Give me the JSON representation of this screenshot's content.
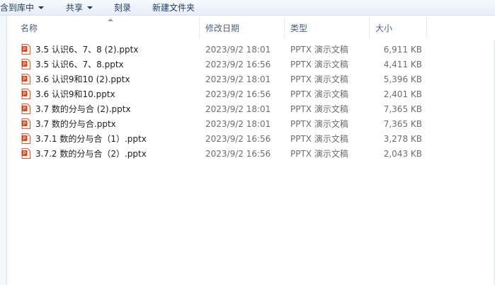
{
  "toolbar": {
    "include_library": "含到库中",
    "share": "共享",
    "burn": "刻录",
    "new_folder": "新建文件夹"
  },
  "columns": {
    "name": "名称",
    "modified": "修改日期",
    "type": "类型",
    "size": "大小"
  },
  "files": [
    {
      "name": "3.5 认识6、7、8 (2).pptx",
      "modified": "2023/9/2 18:01",
      "type": "PPTX 演示文稿",
      "size": "6,911 KB"
    },
    {
      "name": "3.5 认识6、7、8.pptx",
      "modified": "2023/9/2 16:56",
      "type": "PPTX 演示文稿",
      "size": "4,411 KB"
    },
    {
      "name": "3.6 认识9和10 (2).pptx",
      "modified": "2023/9/2 18:01",
      "type": "PPTX 演示文稿",
      "size": "5,396 KB"
    },
    {
      "name": "3.6 认识9和10.pptx",
      "modified": "2023/9/2 16:56",
      "type": "PPTX 演示文稿",
      "size": "2,401 KB"
    },
    {
      "name": "3.7 数的分与合 (2).pptx",
      "modified": "2023/9/2 18:01",
      "type": "PPTX 演示文稿",
      "size": "7,365 KB"
    },
    {
      "name": "3.7 数的分与合.pptx",
      "modified": "2023/9/2 18:01",
      "type": "PPTX 演示文稿",
      "size": "7,365 KB"
    },
    {
      "name": "3.7.1 数的分与合（1）.pptx",
      "modified": "2023/9/2 16:56",
      "type": "PPTX 演示文稿",
      "size": "3,278 KB"
    },
    {
      "name": "3.7.2 数的分与合（2）.pptx",
      "modified": "2023/9/2 16:56",
      "type": "PPTX 演示文稿",
      "size": "2,043 KB"
    }
  ],
  "icons": {
    "file": "pptx-file-icon",
    "accent": "#d24726"
  }
}
